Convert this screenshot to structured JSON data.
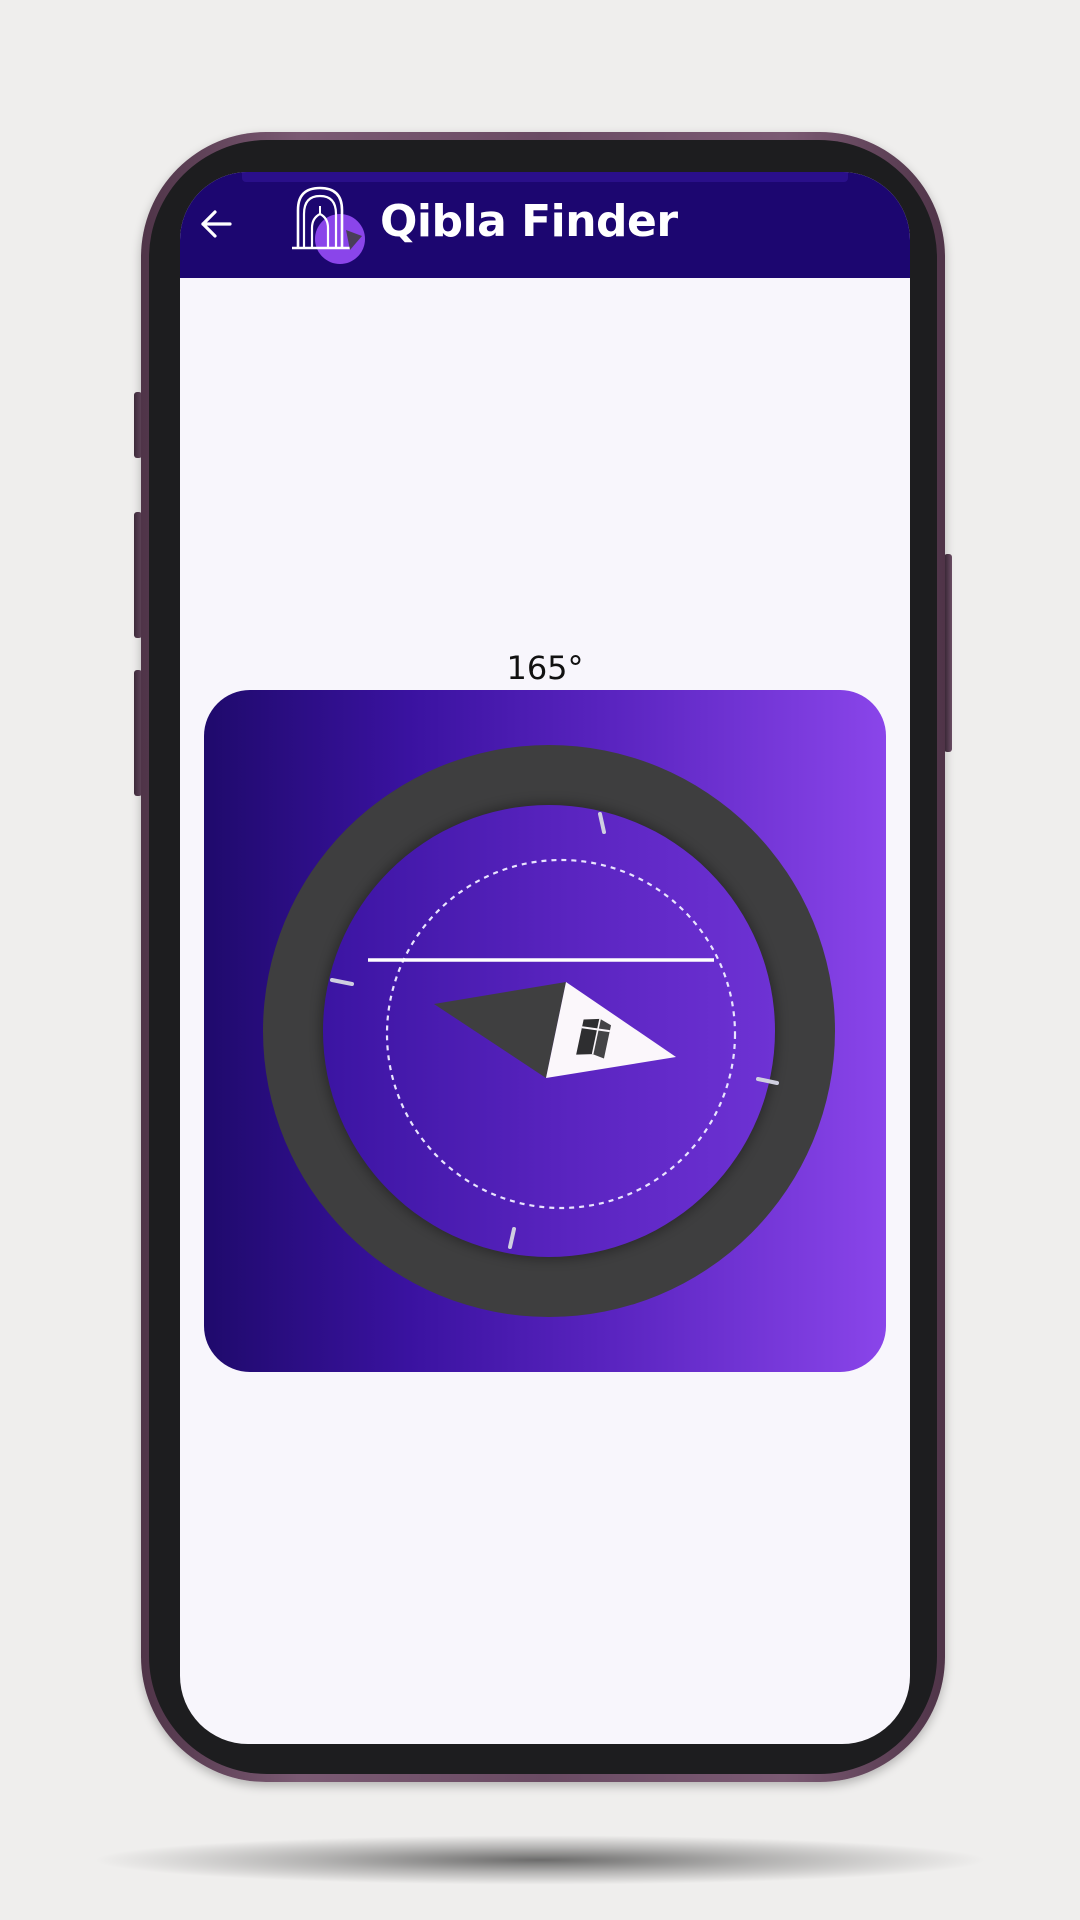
{
  "app_bar": {
    "title": "Qibla Finder",
    "back_icon": "arrow-left-icon",
    "logo_icon": "mosque-logo-icon",
    "background_color": "#1c0670"
  },
  "compass": {
    "heading_label": "165°",
    "needle_icon": "compass-needle-icon",
    "kaaba_icon": "kaaba-icon",
    "card_gradient": [
      "#1f0a6c",
      "#3a12a0",
      "#5a24c0",
      "#8a45ea"
    ],
    "ring_color": "#3d3d3d"
  },
  "screen": {
    "background_color": "#f8f6fc"
  }
}
